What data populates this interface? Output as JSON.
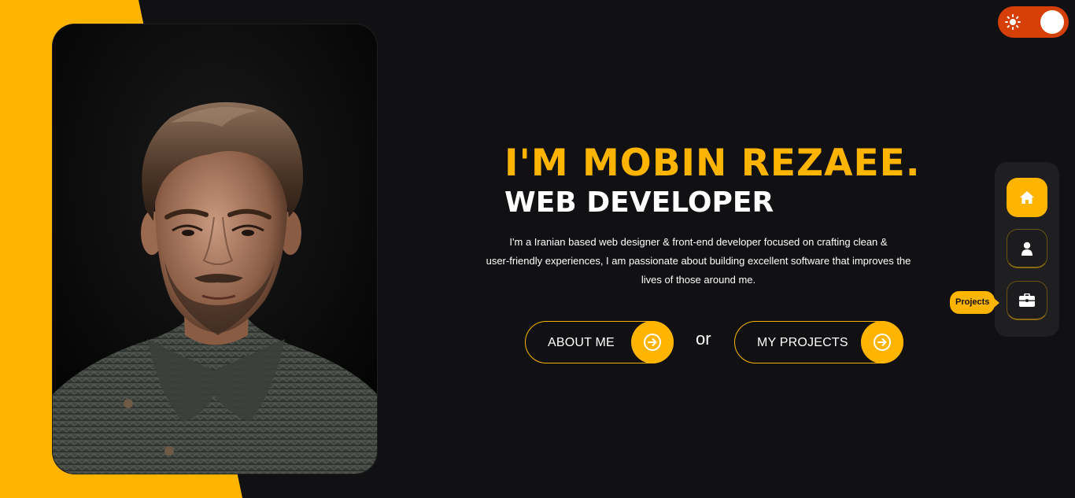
{
  "theme": {
    "accent": "#ffb400",
    "background": "#111114",
    "toggle_color": "#d63f08"
  },
  "theme_toggle": {
    "icon": "sun-icon",
    "state": "light-mode-off"
  },
  "hero": {
    "title": "I'M MOBIN REZAEE.",
    "subtitle": "WEB DEVELOPER",
    "description_line1": "I'm a Iranian based web designer & front-end developer focused on crafting clean &",
    "description_line2": "user-friendly experiences, I am passionate about building excellent software that improves the",
    "description_line3": "lives of those around me."
  },
  "portrait": {
    "icon": "portrait-photo"
  },
  "cta": {
    "about_label": "ABOUT ME",
    "or_label": "or",
    "projects_label": "MY PROJECTS",
    "arrow_icon": "arrow-right-circle-icon"
  },
  "side_nav": {
    "items": [
      {
        "icon": "home-icon",
        "active": true
      },
      {
        "icon": "user-icon",
        "active": false
      },
      {
        "icon": "briefcase-icon",
        "active": false
      }
    ],
    "tooltip": "Projects"
  }
}
